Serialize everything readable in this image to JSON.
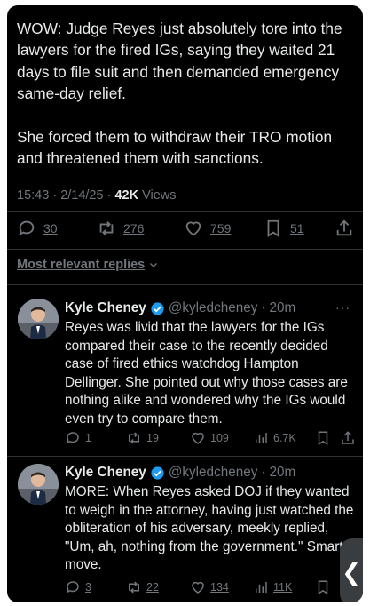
{
  "post": {
    "text": "WOW: Judge Reyes just absolutely tore into the lawyers for the fired IGs, saying they waited 21 days to file suit and then demanded emergency same-day relief.\n\nShe forced them to withdraw their TRO motion and threatened them with sanctions.",
    "time": "15:43",
    "date": "2/14/25",
    "views_count": "42K",
    "views_label": "Views",
    "replies": "30",
    "reposts": "276",
    "likes": "759",
    "bookmarks": "51"
  },
  "replies_filter": "Most relevant replies",
  "replies": [
    {
      "name": "Kyle Cheney",
      "handle": "@kyledcheney",
      "time": "20m",
      "text": "Reyes was livid that the lawyers for the IGs compared their case to the recently decided case of fired ethics watchdog Hampton Dellinger.  She pointed out why those cases are nothing alike and wondered why the IGs would even try to compare them.",
      "replies": "1",
      "reposts": "19",
      "likes": "109",
      "views": "6.7K"
    },
    {
      "name": "Kyle Cheney",
      "handle": "@kyledcheney",
      "time": "20m",
      "text": "MORE: When Reyes asked DOJ if they wanted to weigh in the attorney, having just watched the obliteration of his adversary, meekly replied, \"Um, ah, nothing from the government.\" Smart move.",
      "replies": "3",
      "reposts": "22",
      "likes": "134",
      "views": "11K"
    }
  ],
  "colors": {
    "background": "#000000",
    "text": "#e7e9ea",
    "muted": "#71767b",
    "verified": "#1d9bf0",
    "divider": "#2f3336"
  },
  "icons": [
    "reply-icon",
    "repost-icon",
    "like-icon",
    "bookmark-icon",
    "share-icon",
    "views-icon",
    "verified-badge-icon",
    "chevron-down-icon",
    "more-icon",
    "chevron-left-icon"
  ]
}
